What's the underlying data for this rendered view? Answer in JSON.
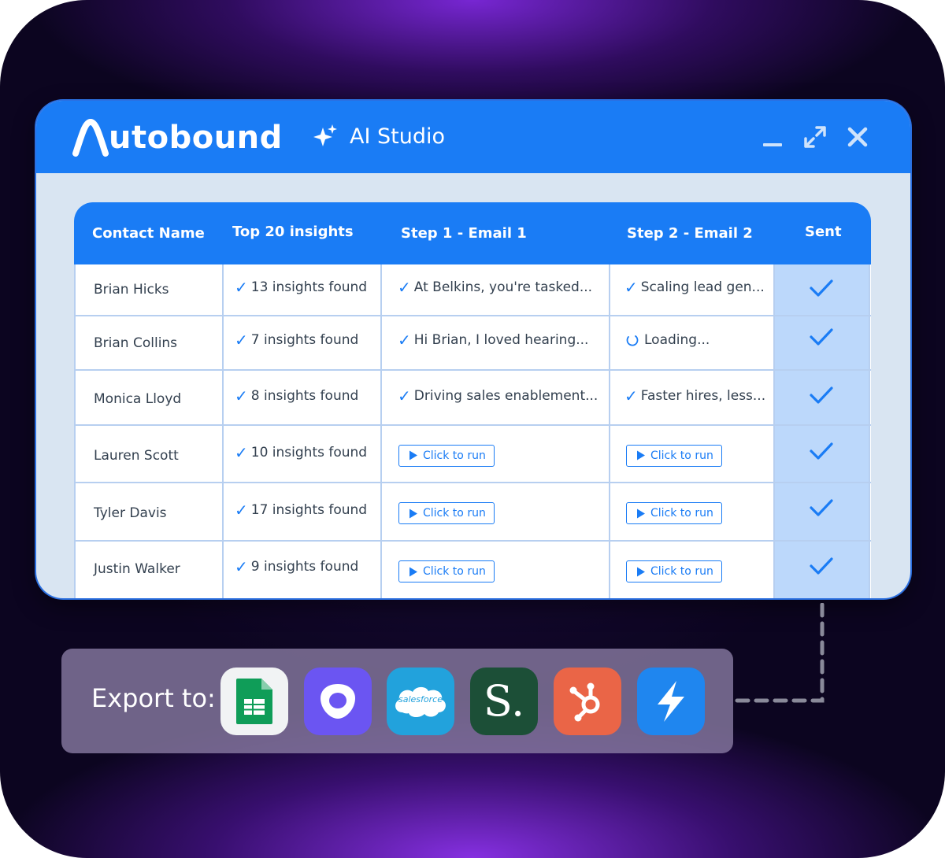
{
  "app": {
    "brand": "utobound",
    "module_title": "AI Studio"
  },
  "table": {
    "headers": [
      "Contact Name",
      "Top 20 insights",
      "Step 1 - Email 1",
      "Step 2 - Email 2",
      "Sent"
    ],
    "rows": [
      {
        "name": "Brian Hicks",
        "insights": "13 insights found",
        "email1": "At Belkins, you're tasked...",
        "email2": "Scaling lead gen...",
        "email1_state": "done",
        "email2_state": "done"
      },
      {
        "name": "Brian Collins",
        "insights": "7 insights found",
        "email1": "Hi Brian, I loved hearing...",
        "email2": "Loading...",
        "email1_state": "done",
        "email2_state": "loading"
      },
      {
        "name": "Monica Lloyd",
        "insights": "8 insights found",
        "email1": "Driving sales enablement...",
        "email2": "Faster hires, less...",
        "email1_state": "done",
        "email2_state": "done"
      },
      {
        "name": "Lauren Scott",
        "insights": "10 insights found",
        "email1": "Click to run",
        "email2": "Click to run",
        "email1_state": "run",
        "email2_state": "run"
      },
      {
        "name": "Tyler Davis",
        "insights": "17 insights found",
        "email1": "Click to run",
        "email2": "Click to run",
        "email1_state": "run",
        "email2_state": "run"
      },
      {
        "name": "Justin Walker",
        "insights": "9 insights found",
        "email1": "Click to run",
        "email2": "Click to run",
        "email1_state": "run",
        "email2_state": "run"
      }
    ]
  },
  "export": {
    "label": "Export to:",
    "destinations": [
      {
        "icon": "google-sheets-icon"
      },
      {
        "icon": "outreach-icon"
      },
      {
        "icon": "salesforce-icon",
        "text": "salesforce"
      },
      {
        "icon": "salesloft-icon",
        "text": "S."
      },
      {
        "icon": "hubspot-icon"
      },
      {
        "icon": "apollo-lightning-icon"
      }
    ]
  },
  "colors": {
    "primary": "#1a7cf5",
    "sent_column": "#bcd8fb",
    "window_bg": "#d9e5f2",
    "export_bar": "#8c7da5"
  }
}
